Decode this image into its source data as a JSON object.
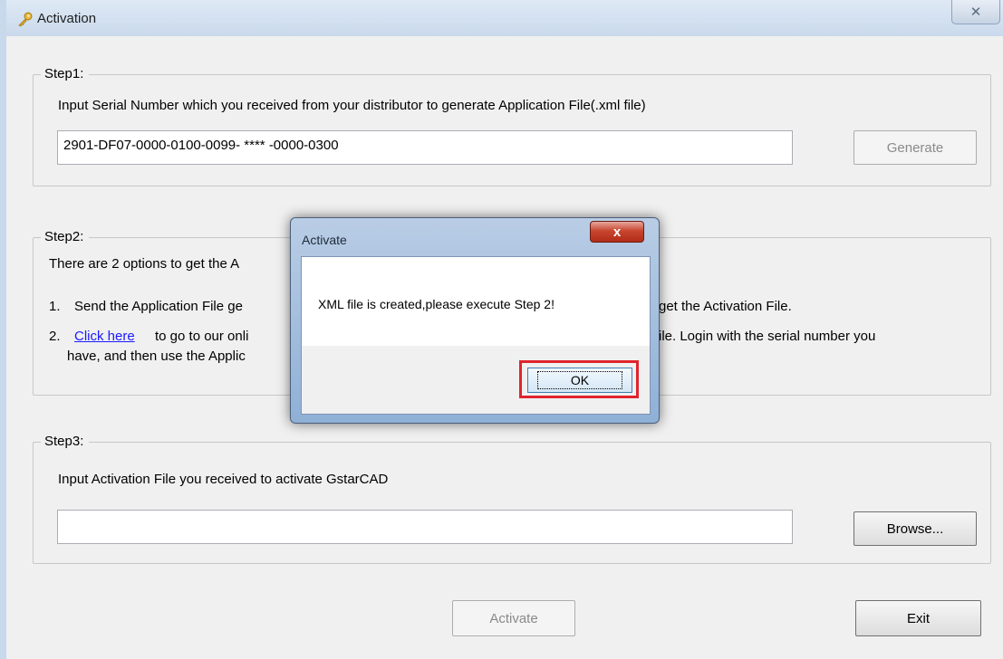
{
  "window": {
    "title": "Activation",
    "close_glyph": "✕"
  },
  "step1": {
    "legend": "Step1:",
    "instruction": "Input Serial Number which you received from your distributor to generate Application File(.xml file)",
    "serial_value": "2901-DF07-0000-0100-0099- **** -0000-0300",
    "generate_label": "Generate"
  },
  "step2": {
    "legend": "Step2:",
    "intro": "There are 2 options to get the A",
    "opt1_num": "1.",
    "opt1_left": "Send the Application File ge",
    "opt1_right": "get the Activation File.",
    "opt2_num": "2.",
    "opt2_link": "Click here",
    "opt2_left": "to go to our onli",
    "opt2_right": "ile. Login with the serial number you",
    "opt2_line2": "have, and then use the Applic"
  },
  "step3": {
    "legend": "Step3:",
    "instruction": "Input Activation File you received to activate GstarCAD",
    "file_value": "",
    "browse_label": "Browse..."
  },
  "footer": {
    "activate_label": "Activate",
    "exit_label": "Exit"
  },
  "dialog": {
    "title": "Activate",
    "close_glyph": "x",
    "message": "XML file is created,please execute Step 2!",
    "ok_label": "OK",
    "highlight_color": "#e0242c"
  }
}
